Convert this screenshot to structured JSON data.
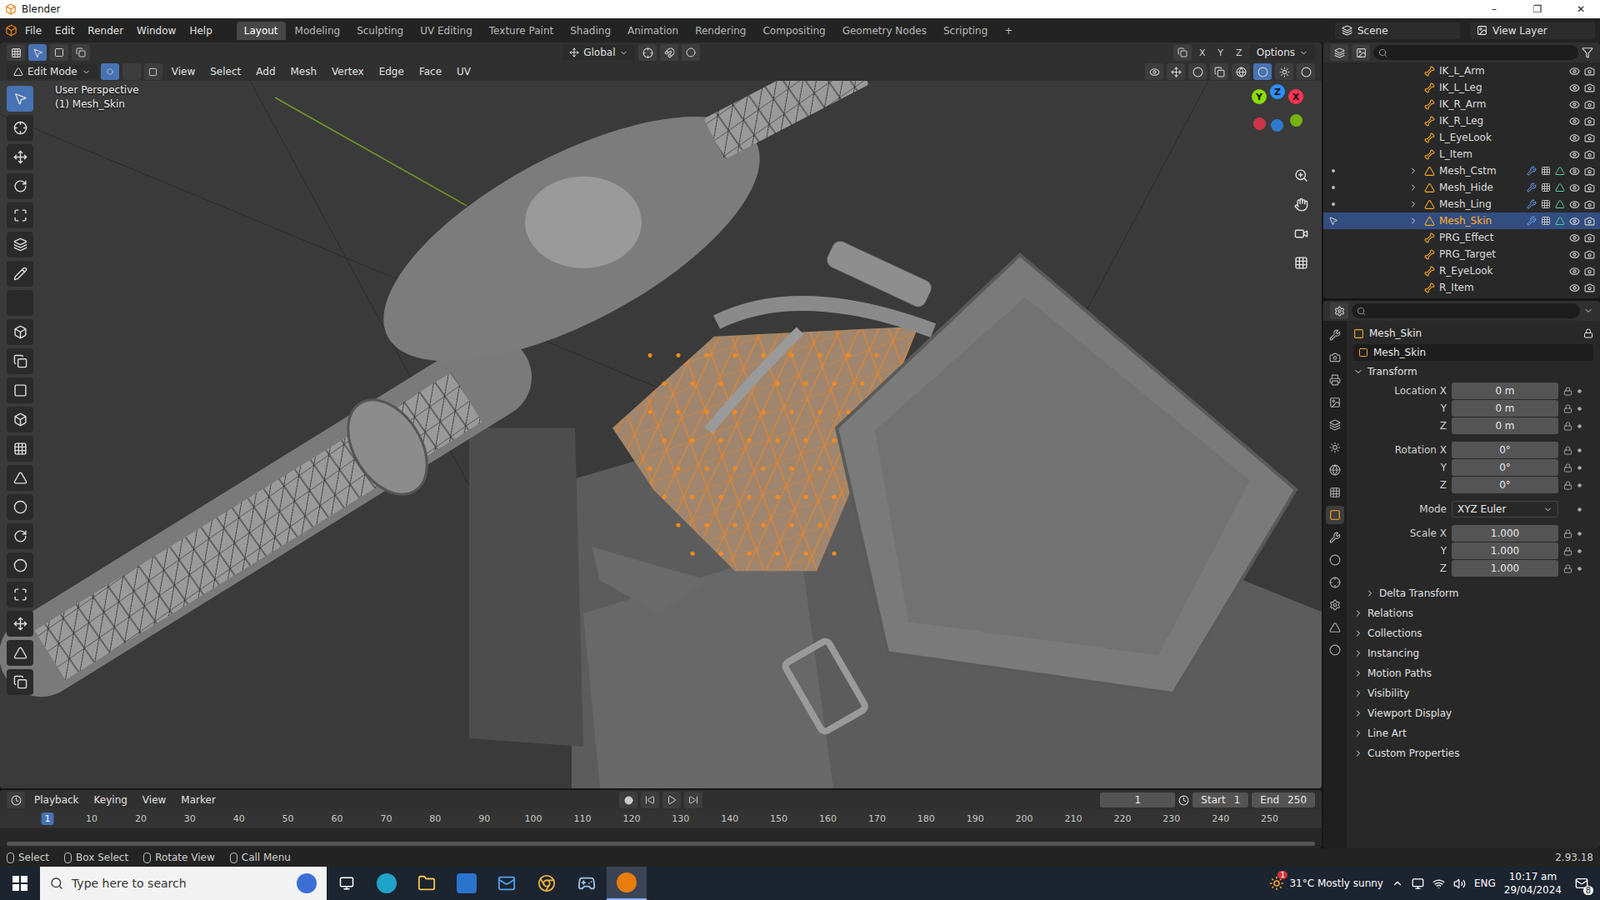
{
  "window": {
    "title": "Blender",
    "controls": [
      "–",
      "❐",
      "✕"
    ]
  },
  "menu": [
    "File",
    "Edit",
    "Render",
    "Window",
    "Help"
  ],
  "workspaces": [
    {
      "label": "Layout",
      "selected": true
    },
    {
      "label": "Modeling",
      "selected": false
    },
    {
      "label": "Sculpting",
      "selected": false
    },
    {
      "label": "UV Editing",
      "selected": false
    },
    {
      "label": "Texture Paint",
      "selected": false
    },
    {
      "label": "Shading",
      "selected": false
    },
    {
      "label": "Animation",
      "selected": false
    },
    {
      "label": "Rendering",
      "selected": false
    },
    {
      "label": "Compositing",
      "selected": false
    },
    {
      "label": "Geometry Nodes",
      "selected": false
    },
    {
      "label": "Scripting",
      "selected": false
    }
  ],
  "workspace_add": "+",
  "scene": "Scene",
  "view_layer": "View Layer",
  "viewport": {
    "tool_header": {
      "orientation": "Global",
      "axes": [
        "X",
        "Y",
        "Z"
      ],
      "options": "Options"
    },
    "header": {
      "mode": "Edit Mode",
      "menus": [
        "View",
        "Select",
        "Add",
        "Mesh",
        "Vertex",
        "Edge",
        "Face",
        "UV"
      ]
    },
    "overlay": [
      "User Perspective",
      "(1) Mesh_Skin"
    ],
    "gizmo": [
      {
        "label": "Y",
        "color": "#8bdc00"
      },
      {
        "label": "Z",
        "color": "#2c8fff"
      },
      {
        "label": "X",
        "color": "#ff3352"
      }
    ],
    "tools": [
      {
        "selected": true
      },
      {
        "selected": false
      },
      {
        "selected": false
      },
      {
        "selected": false
      },
      {
        "selected": false
      },
      {
        "selected": false
      },
      {
        "selected": false
      },
      {
        "selected": false
      },
      {
        "selected": false
      },
      {
        "selected": false
      },
      {
        "selected": false
      },
      {
        "selected": false
      },
      {
        "selected": false
      },
      {
        "selected": false
      },
      {
        "selected": false
      },
      {
        "selected": false
      },
      {
        "selected": false
      },
      {
        "selected": false
      },
      {
        "selected": false
      },
      {
        "selected": false
      },
      {
        "selected": false
      }
    ]
  },
  "outliner": {
    "items": [
      {
        "name": "IK_L_Arm",
        "kind": "bone",
        "selected": false
      },
      {
        "name": "IK_L_Leg",
        "kind": "bone",
        "selected": false
      },
      {
        "name": "IK_R_Arm",
        "kind": "bone",
        "selected": false
      },
      {
        "name": "IK_R_Leg",
        "kind": "bone",
        "selected": false
      },
      {
        "name": "L_EyeLook",
        "kind": "bone",
        "selected": false
      },
      {
        "name": "L_Item",
        "kind": "bone",
        "selected": false
      },
      {
        "name": "Mesh_Cstm",
        "kind": "mesh",
        "selected": false
      },
      {
        "name": "Mesh_Hide",
        "kind": "mesh",
        "selected": false
      },
      {
        "name": "Mesh_Ling",
        "kind": "mesh",
        "selected": false
      },
      {
        "name": "Mesh_Skin",
        "kind": "mesh",
        "selected": true
      },
      {
        "name": "PRG_Effect",
        "kind": "bone",
        "selected": false
      },
      {
        "name": "PRG_Target",
        "kind": "bone",
        "selected": false
      },
      {
        "name": "R_EyeLook",
        "kind": "bone",
        "selected": false
      },
      {
        "name": "R_Item",
        "kind": "bone",
        "selected": false
      }
    ]
  },
  "properties": {
    "tabs": [
      {
        "selected": false
      },
      {
        "selected": false
      },
      {
        "selected": false
      },
      {
        "selected": false
      },
      {
        "selected": false
      },
      {
        "selected": false
      },
      {
        "selected": false
      },
      {
        "selected": false
      },
      {
        "selected": true
      },
      {
        "selected": false
      },
      {
        "selected": false
      },
      {
        "selected": false
      },
      {
        "selected": false
      },
      {
        "selected": false
      },
      {
        "selected": false
      }
    ],
    "object": "Mesh_Skin",
    "datablock": "Mesh_Skin",
    "transform": {
      "label": "Transform",
      "expanded": true,
      "groups": [
        {
          "rows": [
            {
              "label": "Location X",
              "value": "0 m",
              "kind": "number"
            },
            {
              "label": "Y",
              "value": "0 m",
              "kind": "number"
            },
            {
              "label": "Z",
              "value": "0 m",
              "kind": "number"
            }
          ]
        },
        {
          "rows": [
            {
              "label": "Rotation X",
              "value": "0°",
              "kind": "number"
            },
            {
              "label": "Y",
              "value": "0°",
              "kind": "number"
            },
            {
              "label": "Z",
              "value": "0°",
              "kind": "number"
            }
          ]
        },
        {
          "rows": [
            {
              "label": "Mode",
              "value": "XYZ Euler",
              "kind": "select"
            }
          ]
        },
        {
          "rows": [
            {
              "label": "Scale X",
              "value": "1.000",
              "kind": "number"
            },
            {
              "label": "Y",
              "value": "1.000",
              "kind": "number"
            },
            {
              "label": "Z",
              "value": "1.000",
              "kind": "number"
            }
          ]
        }
      ]
    },
    "panels": [
      {
        "label": "Delta Transform",
        "kind": "subpanel",
        "expanded": false
      },
      {
        "label": "Relations",
        "kind": "panel",
        "expanded": false
      },
      {
        "label": "Collections",
        "kind": "panel",
        "expanded": false
      },
      {
        "label": "Instancing",
        "kind": "panel",
        "expanded": false
      },
      {
        "label": "Motion Paths",
        "kind": "panel",
        "expanded": false
      },
      {
        "label": "Visibility",
        "kind": "panel",
        "expanded": false
      },
      {
        "label": "Viewport Display",
        "kind": "panel",
        "expanded": false
      },
      {
        "label": "Line Art",
        "kind": "panel",
        "expanded": false
      },
      {
        "label": "Custom Properties",
        "kind": "panel",
        "expanded": false
      }
    ]
  },
  "timeline": {
    "menus": [
      "Playback",
      "Keying",
      "View",
      "Marker"
    ],
    "frame": "1",
    "start_label": "Start",
    "start": "1",
    "end_label": "End",
    "end": "250",
    "ticks": [
      "1",
      "10",
      "20",
      "30",
      "40",
      "50",
      "60",
      "70",
      "80",
      "90",
      "100",
      "110",
      "120",
      "130",
      "140",
      "150",
      "160",
      "170",
      "180",
      "190",
      "200",
      "210",
      "220",
      "230",
      "240",
      "250"
    ],
    "current": "1"
  },
  "status": {
    "hints": [
      "Select",
      "Box Select",
      "Rotate View",
      "Call Menu"
    ],
    "version": "2.93.18"
  },
  "taskbar": {
    "search": "Type here to search",
    "weather_badge": "1",
    "weather": "31°C  Mostly sunny",
    "lang": "ENG",
    "time": "10:17 am",
    "date": "29/04/2024",
    "notifications": "8"
  }
}
